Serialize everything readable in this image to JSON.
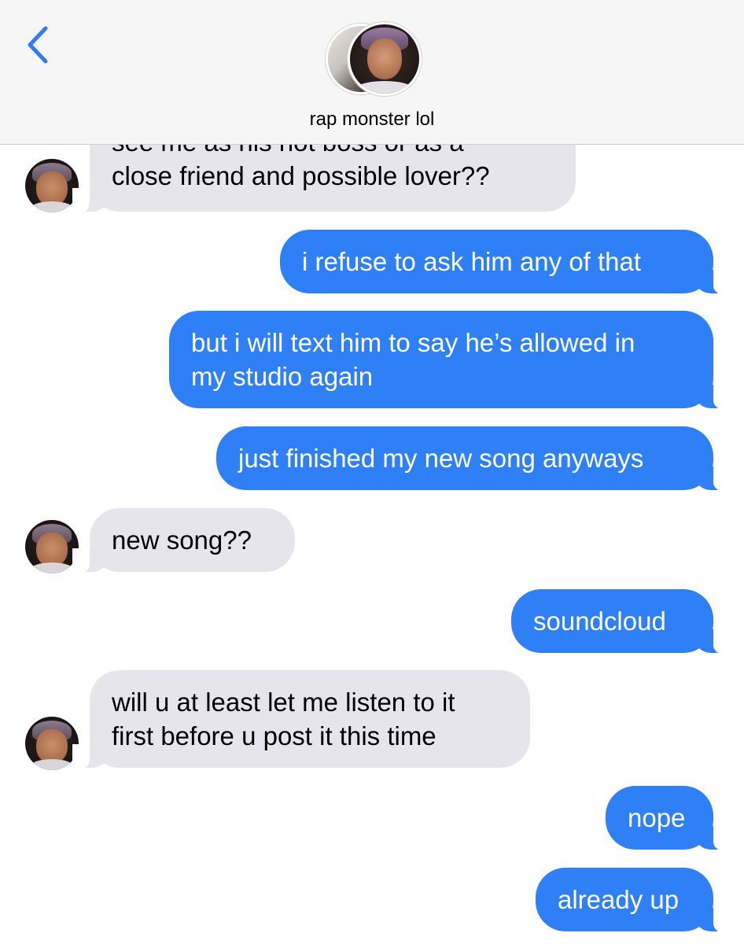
{
  "header": {
    "contact_name": "rap monster lol",
    "back_icon": "chevron-left-icon"
  },
  "colors": {
    "outgoing_bubble": "#2f80f6",
    "incoming_bubble": "#e6e5eb",
    "accent": "#2f7cf6"
  },
  "messages": [
    {
      "direction": "incoming",
      "lines": [
        "see me as his hot boss or as a",
        "close friend and possible lover??"
      ]
    },
    {
      "direction": "outgoing",
      "lines": [
        "i refuse to ask him any of that"
      ]
    },
    {
      "direction": "outgoing",
      "lines": [
        "but i will text him to say he’s allowed in",
        "my studio again"
      ]
    },
    {
      "direction": "outgoing",
      "lines": [
        "just finished my new song anyways"
      ]
    },
    {
      "direction": "incoming",
      "lines": [
        "new song??"
      ]
    },
    {
      "direction": "outgoing",
      "lines": [
        "soundcloud"
      ]
    },
    {
      "direction": "incoming",
      "lines": [
        "will u at least let me listen to it",
        "first before u post it this time"
      ]
    },
    {
      "direction": "outgoing",
      "lines": [
        "nope"
      ]
    },
    {
      "direction": "outgoing",
      "lines": [
        "already up"
      ]
    }
  ]
}
